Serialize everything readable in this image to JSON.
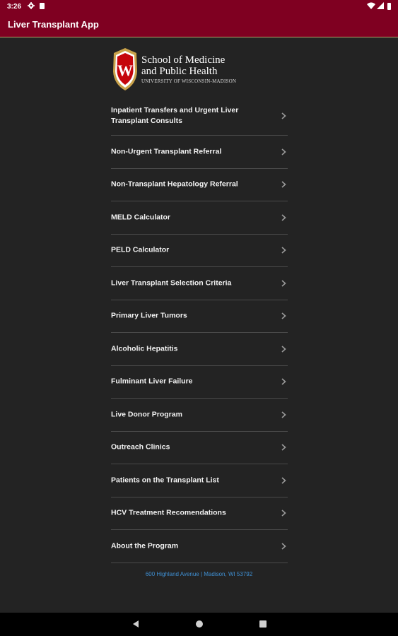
{
  "status_bar": {
    "time": "3:26",
    "icons": [
      "gear-icon",
      "sd-card-icon",
      "wifi-icon",
      "signal-icon",
      "battery-icon"
    ]
  },
  "app_bar": {
    "title": "Liver Transplant App",
    "color": "#7f0021"
  },
  "logo": {
    "line1": "School of Medicine",
    "line2": "and Public Health",
    "university": "UNIVERSITY OF WISCONSIN-MADISON",
    "crest_letter": "W"
  },
  "menu": {
    "items": [
      {
        "label": "Inpatient Transfers and Urgent Liver Transplant Consults"
      },
      {
        "label": "Non-Urgent Transplant Referral"
      },
      {
        "label": "Non-Transplant Hepatology Referral"
      },
      {
        "label": "MELD Calculator"
      },
      {
        "label": "PELD Calculator"
      },
      {
        "label": "Liver Transplant Selection Criteria"
      },
      {
        "label": "Primary Liver Tumors"
      },
      {
        "label": "Alcoholic Hepatitis"
      },
      {
        "label": "Fulminant Liver Failure"
      },
      {
        "label": "Live Donor Program"
      },
      {
        "label": "Outreach Clinics"
      },
      {
        "label": "Patients on the Transplant List"
      },
      {
        "label": "HCV Treatment Recomendations"
      },
      {
        "label": "About the Program"
      }
    ]
  },
  "footer": {
    "address": "600 Highland Avenue | Madison, WI 53792",
    "link_color": "#3f8fd2"
  },
  "nav_bar": {
    "buttons": [
      "back-icon",
      "home-icon",
      "recents-icon"
    ]
  }
}
